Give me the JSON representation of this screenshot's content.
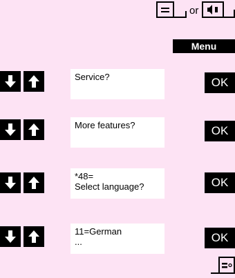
{
  "top_keys": {
    "or_text": "or"
  },
  "menu": {
    "label": "Menu"
  },
  "steps": [
    {
      "display_lines": [
        "Service?"
      ],
      "ok_label": "OK"
    },
    {
      "display_lines": [
        "More features?"
      ],
      "ok_label": "OK"
    },
    {
      "display_lines": [
        "*48=",
        "Select language?"
      ],
      "ok_label": "OK"
    },
    {
      "display_lines": [
        "11=German",
        "..."
      ],
      "ok_label": "OK"
    }
  ]
}
